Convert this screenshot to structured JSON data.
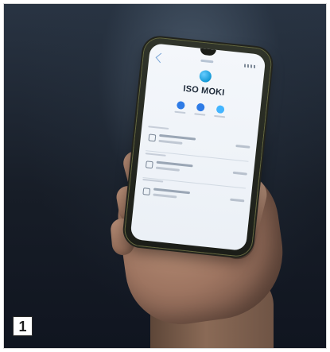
{
  "screen": {
    "contact_name": "ISO MOKI"
  },
  "image_badge": {
    "number": "1"
  },
  "palette": {
    "background": "#171d27",
    "skin": "#9e7561",
    "screen": "#f4f7fb",
    "accent": "#2e7be6"
  }
}
